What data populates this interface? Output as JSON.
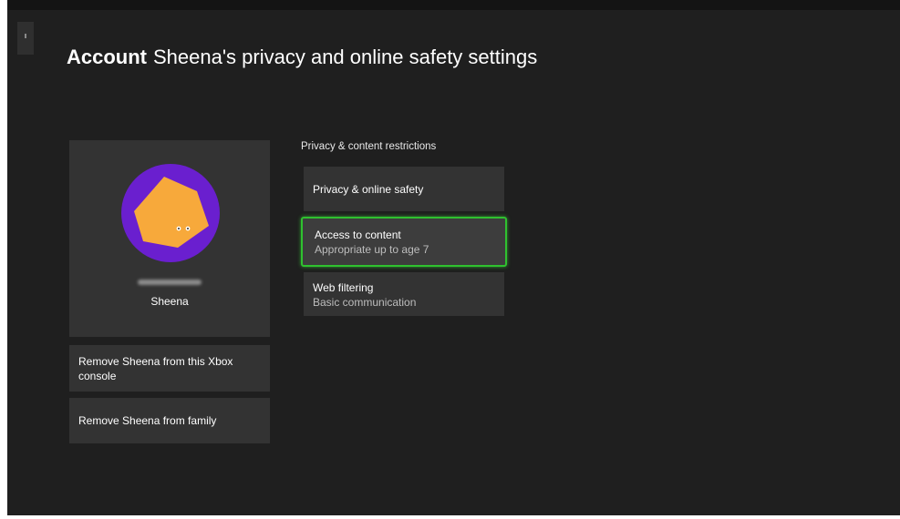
{
  "header": {
    "bold_title": "Account",
    "subtitle": "Sheena's privacy and online safety settings"
  },
  "profile": {
    "name": "Sheena",
    "avatar_colors": {
      "ring": "#6a1fcf",
      "shape": "#f7a93b"
    }
  },
  "actions": {
    "remove_console": "Remove Sheena from this Xbox console",
    "remove_family": "Remove Sheena from family"
  },
  "privacy": {
    "section_label": "Privacy & content restrictions",
    "items": [
      {
        "title": "Privacy & online safety",
        "subtitle": ""
      },
      {
        "title": "Access to content",
        "subtitle": "Appropriate up to age 7"
      },
      {
        "title": "Web filtering",
        "subtitle": "Basic communication"
      }
    ]
  },
  "colors": {
    "focus": "#2fc12f",
    "background": "#1f1f1f",
    "tile": "#333333"
  }
}
